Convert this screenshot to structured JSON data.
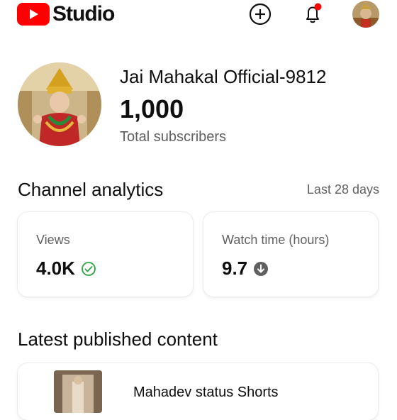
{
  "header": {
    "logo_text": "Studio",
    "icons": [
      "youtube-logo",
      "create-plus-icon",
      "bell-icon",
      "account-avatar"
    ],
    "brand_color": "#ff0000",
    "notification_dot_color": "#ff0000"
  },
  "channel": {
    "name": "Jai Mahakal Official-9812",
    "subscribers": "1,000",
    "subscribers_label": "Total subscribers"
  },
  "analytics": {
    "title": "Channel analytics",
    "range": "Last 28 days",
    "cards": [
      {
        "label": "Views",
        "value": "4.0K",
        "status_icon": "check-circle-icon",
        "status_color": "#2ba640"
      },
      {
        "label": "Watch time (hours)",
        "value": "9.7",
        "status_icon": "arrow-down-circle-icon",
        "status_color": "#606060"
      }
    ]
  },
  "latest": {
    "title": "Latest published content",
    "video_title": "Mahadev status Shorts"
  }
}
